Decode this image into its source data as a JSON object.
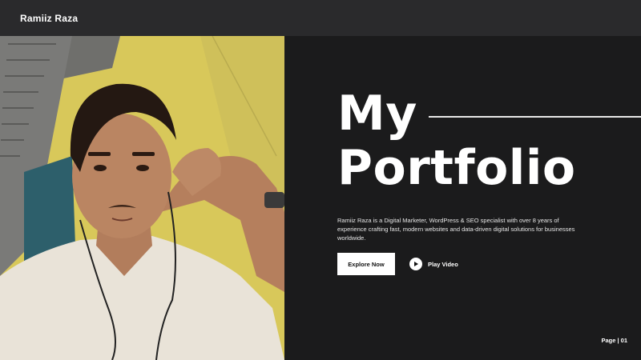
{
  "header": {
    "brand": "Ramiiz Raza"
  },
  "hero": {
    "title_line1": "My",
    "title_line2": "Portfolio",
    "description": "Ramiiz Raza is a Digital Marketer, WordPress & SEO specialist with over 8 years of experience crafting fast, modern websites and data-driven digital solutions for businesses worldwide.",
    "explore_label": "Explore Now",
    "play_label": "Play Video"
  },
  "footer": {
    "page": "Page | 01"
  },
  "colors": {
    "background": "#1b1b1c",
    "topbar": "#2a2a2c",
    "accent": "#ffffff"
  },
  "icons": {
    "play": "play-icon"
  }
}
